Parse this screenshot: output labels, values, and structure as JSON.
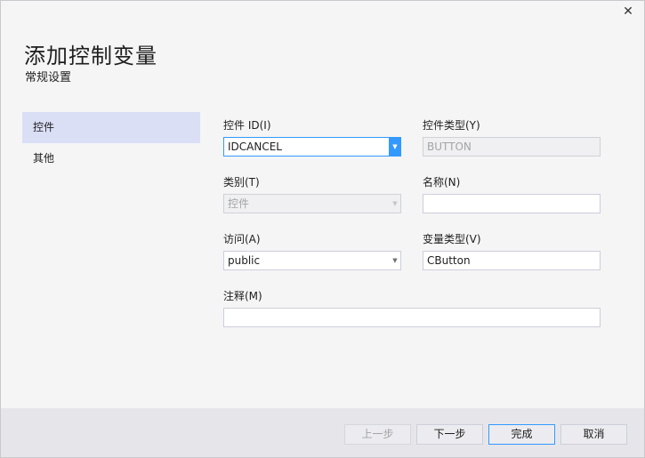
{
  "dialog": {
    "title": "添加控制变量",
    "subtitle": "常规设置",
    "close_glyph": "✕"
  },
  "nav": {
    "items": [
      {
        "label": "控件",
        "active": true
      },
      {
        "label": "其他",
        "active": false
      }
    ]
  },
  "form": {
    "control_id": {
      "label": "控件 ID(I)",
      "value": "IDCANCEL"
    },
    "control_type": {
      "label": "控件类型(Y)",
      "value": "BUTTON"
    },
    "category": {
      "label": "类别(T)",
      "value": "控件"
    },
    "name": {
      "label": "名称(N)",
      "value": ""
    },
    "access": {
      "label": "访问(A)",
      "value": "public"
    },
    "var_type": {
      "label": "变量类型(V)",
      "value": "CButton"
    },
    "comment": {
      "label": "注释(M)",
      "value": ""
    }
  },
  "buttons": {
    "prev": "上一步",
    "next": "下一步",
    "finish": "完成",
    "cancel": "取消"
  },
  "icons": {
    "dropdown_glyph": "▼"
  },
  "colors": {
    "accent": "#3399ff",
    "nav_active": "#dadff6",
    "background": "#f5f5f6",
    "footer": "#e6e6ea"
  }
}
